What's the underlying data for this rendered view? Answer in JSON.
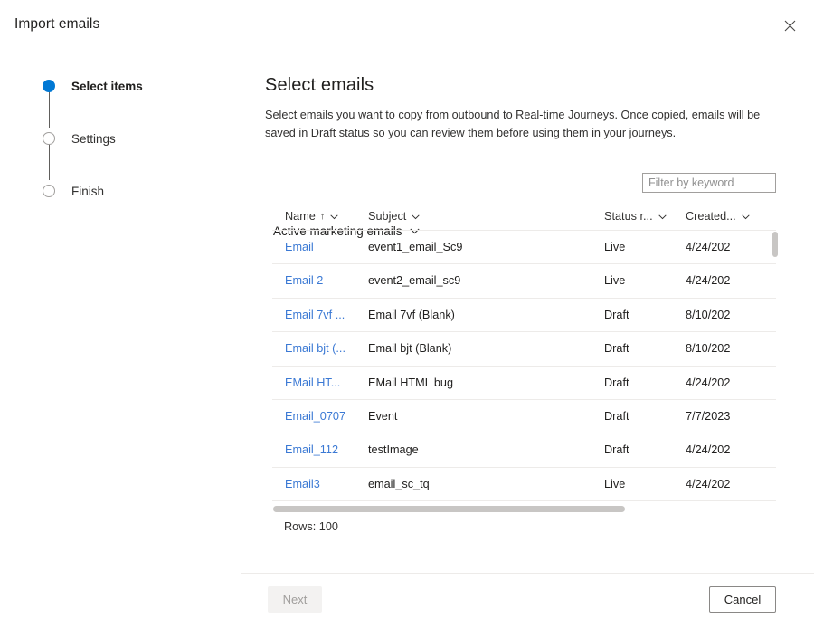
{
  "dialog": {
    "title": "Import emails",
    "close_icon": "close-icon"
  },
  "wizard": {
    "steps": [
      {
        "label": "Select items",
        "state": "active"
      },
      {
        "label": "Settings",
        "state": "inactive"
      },
      {
        "label": "Finish",
        "state": "inactive"
      }
    ]
  },
  "main": {
    "title": "Select emails",
    "description": "Select emails you want to copy from outbound to Real-time Journeys. Once copied, emails will be saved in Draft status so you can review them before using them in your journeys.",
    "view_picker": {
      "label": "Active marketing emails",
      "chevron_icon": "chevron-down-icon"
    },
    "search": {
      "placeholder": "Filter by keyword",
      "value": ""
    },
    "table": {
      "columns": [
        {
          "label": "Name",
          "sort": "↑",
          "chevron_icon": "chevron-down-icon"
        },
        {
          "label": "Subject",
          "sort": "",
          "chevron_icon": "chevron-down-icon"
        },
        {
          "label": "Status r...",
          "sort": "",
          "chevron_icon": "chevron-down-icon"
        },
        {
          "label": "Created...",
          "sort": "",
          "chevron_icon": "chevron-down-icon"
        }
      ],
      "rows": [
        {
          "name": "Email",
          "subject": "event1_email_Sc9",
          "status": "Live",
          "created": "4/24/202"
        },
        {
          "name": "Email 2",
          "subject": "event2_email_sc9",
          "status": "Live",
          "created": "4/24/202"
        },
        {
          "name": "Email 7vf ...",
          "subject": "Email 7vf (Blank)",
          "status": "Draft",
          "created": "8/10/202"
        },
        {
          "name": "Email bjt (...",
          "subject": "Email bjt (Blank)",
          "status": "Draft",
          "created": "8/10/202"
        },
        {
          "name": "EMail HT...",
          "subject": "EMail HTML bug",
          "status": "Draft",
          "created": "4/24/202"
        },
        {
          "name": "Email_0707",
          "subject": "Event",
          "status": "Draft",
          "created": "7/7/2023"
        },
        {
          "name": "Email_112",
          "subject": "testImage",
          "status": "Draft",
          "created": "4/24/202"
        },
        {
          "name": "Email3",
          "subject": "email_sc_tq",
          "status": "Live",
          "created": "4/24/202"
        }
      ],
      "rows_count": "Rows: 100"
    }
  },
  "footer": {
    "next_label": "Next",
    "cancel_label": "Cancel"
  },
  "colors": {
    "accent": "#0078d4",
    "link": "#3b79d4",
    "border": "#e1dfdd",
    "row_border": "#edebe9",
    "scrollbar": "#c8c6c4",
    "disabled_bg": "#f3f2f1",
    "disabled_text": "#a19f9d"
  }
}
